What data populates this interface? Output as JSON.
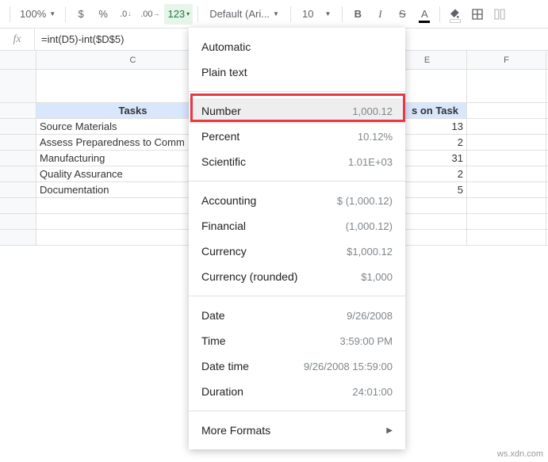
{
  "toolbar": {
    "zoom": "100%",
    "currency_symbol": "$",
    "percent_symbol": "%",
    "decrease_decimal": ".0",
    "increase_decimal": ".00",
    "format_button": "123",
    "font_name": "Default (Ari...",
    "font_size": "10",
    "bold": "B",
    "italic": "I",
    "strike": "S",
    "text_color": "A"
  },
  "formula_bar": {
    "fx": "fx",
    "value": "=int(D5)-int($D$5)"
  },
  "columns": {
    "C": "C",
    "E": "E",
    "F": "F"
  },
  "header_row": {
    "tasks": "Tasks",
    "days_on_task": "s on Task"
  },
  "rows": [
    {
      "task": "Source Materials",
      "days": "13"
    },
    {
      "task": "Assess Preparedness to Comm",
      "days": "2"
    },
    {
      "task": "Manufacturing",
      "days": "31"
    },
    {
      "task": "Quality Assurance",
      "days": "2"
    },
    {
      "task": "Documentation",
      "days": "5"
    }
  ],
  "menu": {
    "automatic": "Automatic",
    "plain_text": "Plain text",
    "number": {
      "label": "Number",
      "sample": "1,000.12"
    },
    "percent": {
      "label": "Percent",
      "sample": "10.12%"
    },
    "scientific": {
      "label": "Scientific",
      "sample": "1.01E+03"
    },
    "accounting": {
      "label": "Accounting",
      "sample": "$ (1,000.12)"
    },
    "financial": {
      "label": "Financial",
      "sample": "(1,000.12)"
    },
    "currency": {
      "label": "Currency",
      "sample": "$1,000.12"
    },
    "currency_rounded": {
      "label": "Currency (rounded)",
      "sample": "$1,000"
    },
    "date": {
      "label": "Date",
      "sample": "9/26/2008"
    },
    "time": {
      "label": "Time",
      "sample": "3:59:00 PM"
    },
    "datetime": {
      "label": "Date time",
      "sample": "9/26/2008 15:59:00"
    },
    "duration": {
      "label": "Duration",
      "sample": "24:01:00"
    },
    "more_formats": "More Formats"
  },
  "watermark": "ws.xdn.com"
}
